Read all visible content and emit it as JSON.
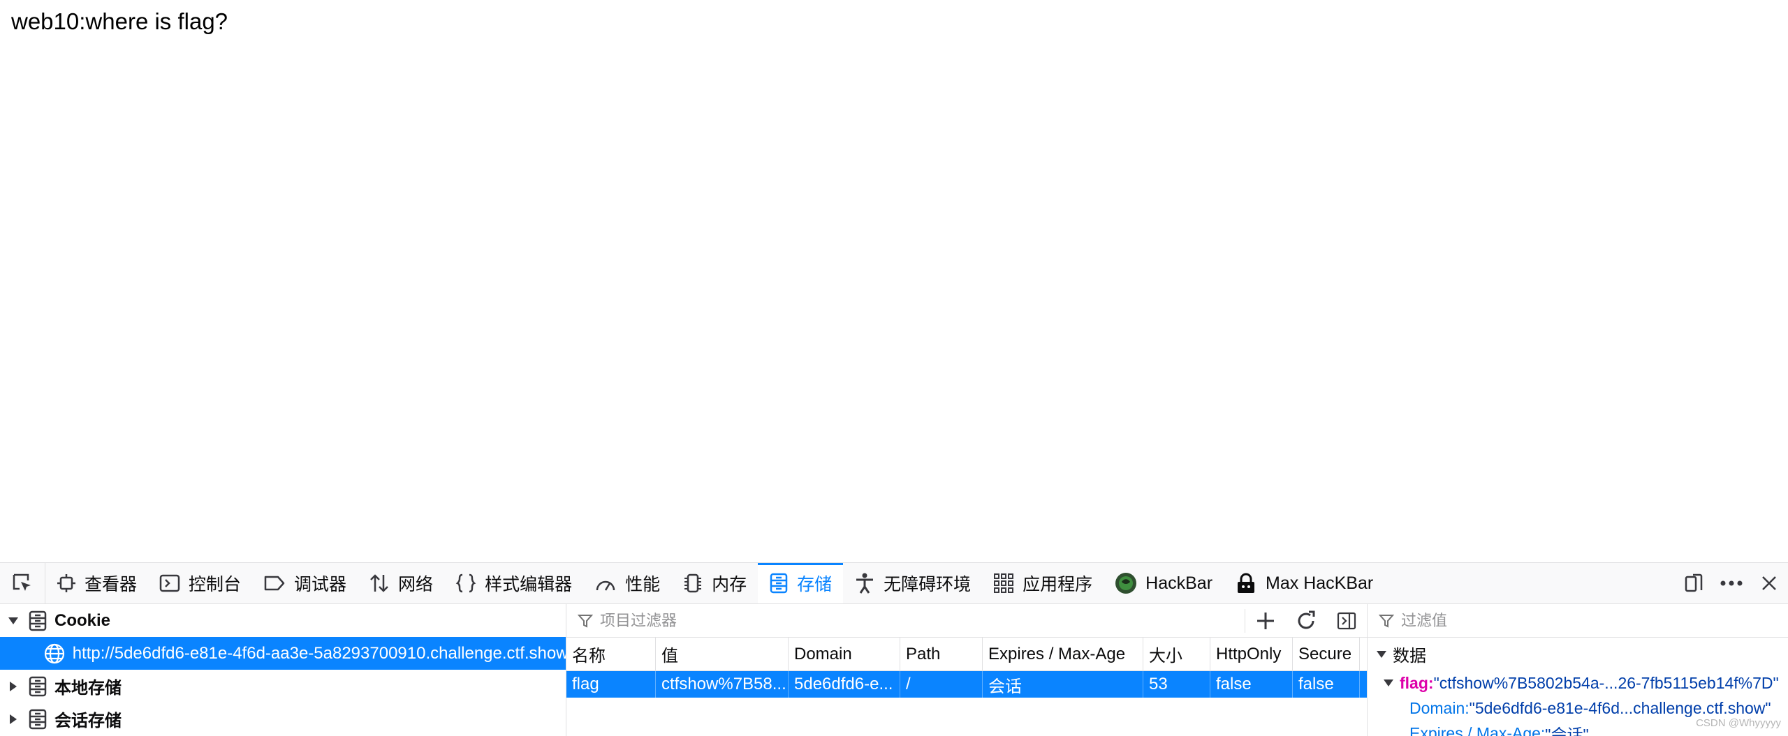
{
  "page": {
    "text": "web10:where is flag?"
  },
  "devtools": {
    "tabs": [
      {
        "label": "查看器",
        "icon": "inspector-icon"
      },
      {
        "label": "控制台",
        "icon": "console-icon"
      },
      {
        "label": "调试器",
        "icon": "debugger-icon"
      },
      {
        "label": "网络",
        "icon": "network-icon"
      },
      {
        "label": "样式编辑器",
        "icon": "style-editor-icon"
      },
      {
        "label": "性能",
        "icon": "performance-icon"
      },
      {
        "label": "内存",
        "icon": "memory-icon"
      },
      {
        "label": "存储",
        "icon": "storage-icon",
        "active": true
      },
      {
        "label": "无障碍环境",
        "icon": "accessibility-icon"
      },
      {
        "label": "应用程序",
        "icon": "application-icon"
      },
      {
        "label": "HackBar",
        "icon": "hackbar-icon"
      },
      {
        "label": "Max HacKBar",
        "icon": "max-hackbar-icon"
      }
    ],
    "sidebar": {
      "cookie_label": "Cookie",
      "cookie_host": "http://5de6dfd6-e81e-4f6d-aa3e-5a8293700910.challenge.ctf.show",
      "local_storage_label": "本地存储",
      "session_storage_label": "会话存储"
    },
    "table": {
      "filter_placeholder": "项目过滤器",
      "headers": [
        "名称",
        "值",
        "Domain",
        "Path",
        "Expires / Max-Age",
        "大小",
        "HttpOnly",
        "Secure"
      ],
      "rows": [
        [
          "flag",
          "ctfshow%7B58...",
          "5de6dfd6-e...",
          "/",
          "会话",
          "53",
          "false",
          "false"
        ]
      ]
    },
    "details": {
      "filter_placeholder": "过滤值",
      "section_label": "数据",
      "flag_key": "flag",
      "flag_value": "\"ctfshow%7B5802b54a-...26-7fb5115eb14f%7D\"",
      "domain_key": "Domain",
      "domain_value": "\"5de6dfd6-e81e-4f6d...challenge.ctf.show\"",
      "expires_key": "Expires / Max-Age",
      "expires_value": "\"会话\""
    },
    "watermark": "CSDN @Whyyyyy"
  },
  "colors": {
    "accent": "#0a84ff",
    "key": "#dd00a9",
    "string": "#003eaa"
  }
}
